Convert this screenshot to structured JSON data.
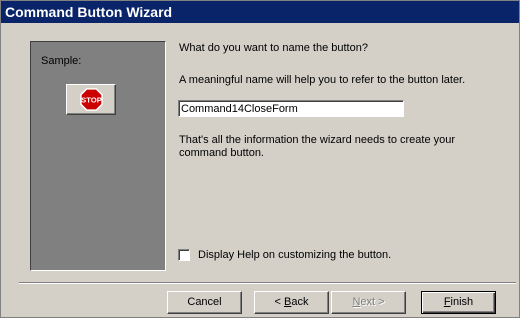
{
  "window": {
    "title": "Command Button Wizard"
  },
  "sample": {
    "label": "Sample:",
    "button_icon": "stop-sign-icon",
    "button_icon_text": "STOP"
  },
  "main": {
    "question": "What do you want to name the button?",
    "hint": "A meaningful name will help you to refer to the button later.",
    "name_value": "Command14CloseForm",
    "info_line1": "That's all the information the wizard needs to create your",
    "info_line2": "command button.",
    "help_checkbox_label": "Display Help on customizing the button.",
    "help_checkbox_checked": false
  },
  "buttons": {
    "cancel": "Cancel",
    "back_mnemonic": "B",
    "back_rest": "ack",
    "next_mnemonic": "N",
    "next_rest": "ext >",
    "finish_mnemonic": "F",
    "finish_rest": "inish"
  }
}
